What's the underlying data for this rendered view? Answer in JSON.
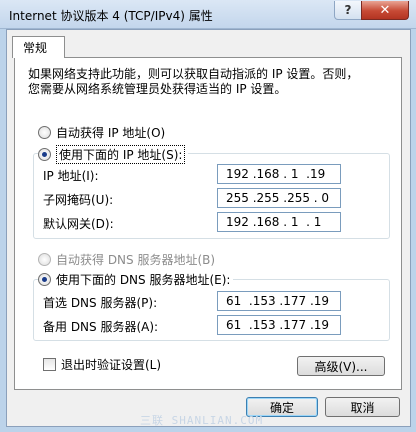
{
  "window": {
    "title": "Internet 协议版本 4 (TCP/IPv4) 属性",
    "help_label": "?",
    "close_label": "✕"
  },
  "tabs": [
    {
      "label": "常规",
      "active": true
    }
  ],
  "description": [
    "如果网络支持此功能，则可以获取自动指派的 IP 设置。否则，",
    "您需要从网络系统管理员处获得适当的 IP 设置。"
  ],
  "ip_section": {
    "auto_label": "自动获得 IP 地址(O)",
    "manual_label": "使用下面的 IP 地址(S):",
    "selected": "manual",
    "fields": [
      {
        "label": "IP 地址(I):",
        "value": "192 .168 . 1  .19"
      },
      {
        "label": "子网掩码(U):",
        "value": "255 .255 .255 . 0"
      },
      {
        "label": "默认网关(D):",
        "value": "192 .168 . 1  . 1"
      }
    ]
  },
  "dns_section": {
    "auto_label": "自动获得 DNS 服务器地址(B)",
    "manual_label": "使用下面的 DNS 服务器地址(E):",
    "selected": "manual",
    "fields": [
      {
        "label": "首选 DNS 服务器(P):",
        "value": "61  .153 .177 .19"
      },
      {
        "label": "备用 DNS 服务器(A):",
        "value": "61  .153 .177 .19"
      }
    ]
  },
  "validate_checkbox": {
    "label": "退出时验证设置(L)",
    "checked": false
  },
  "buttons": {
    "advanced": "高级(V)...",
    "ok": "确定",
    "cancel": "取消"
  },
  "watermark": "三联 SHANLIAN.COM"
}
